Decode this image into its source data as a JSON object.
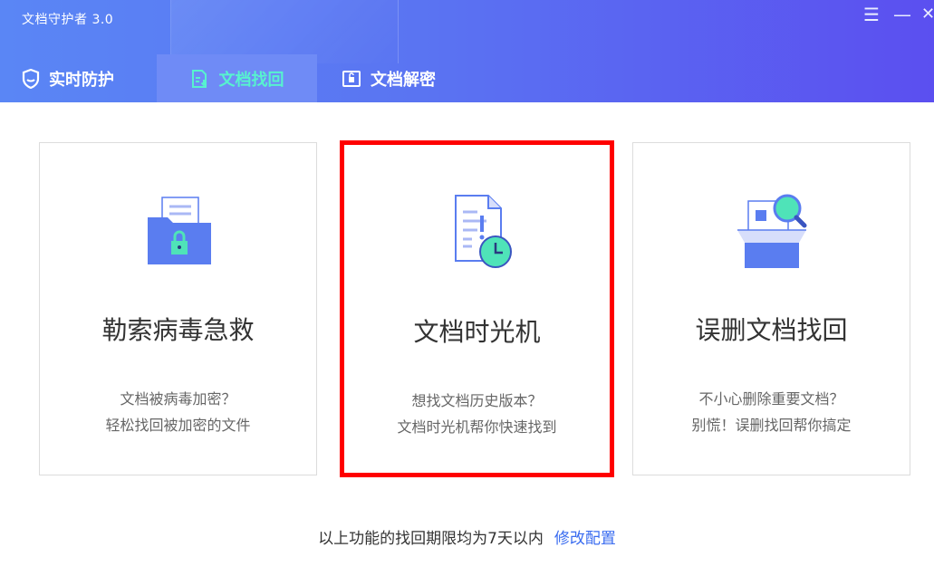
{
  "app": {
    "title": "文档守护者 3.0"
  },
  "window_controls": {
    "menu": "☰",
    "minimize": "—",
    "close": "✕"
  },
  "tabs": [
    {
      "label": "实时防护",
      "icon": "shield-icon",
      "active": false
    },
    {
      "label": "文档找回",
      "icon": "document-recover-icon",
      "active": true
    },
    {
      "label": "文档解密",
      "icon": "document-unlock-icon",
      "active": false
    }
  ],
  "cards": [
    {
      "title": "勒索病毒急救",
      "desc_line1": "文档被病毒加密？",
      "desc_line2": "轻松找回被加密的文件",
      "icon": "locked-folder-icon"
    },
    {
      "title": "文档时光机",
      "desc_line1": "想找文档历史版本？",
      "desc_line2": "文档时光机帮你快速找到",
      "icon": "document-clock-icon",
      "highlighted": true
    },
    {
      "title": "误删文档找回",
      "desc_line1": "不小心删除重要文档？",
      "desc_line2": "别慌！误删找回帮你搞定",
      "icon": "box-search-icon"
    }
  ],
  "footer": {
    "text": "以上功能的找回期限均为7天以内",
    "link": "修改配置"
  },
  "colors": {
    "accent": "#3a6cf0",
    "active_tab_text": "#57f2cf",
    "highlight_border": "#ff0000",
    "header_start": "#5a86f5",
    "header_end": "#5b4ff0"
  }
}
